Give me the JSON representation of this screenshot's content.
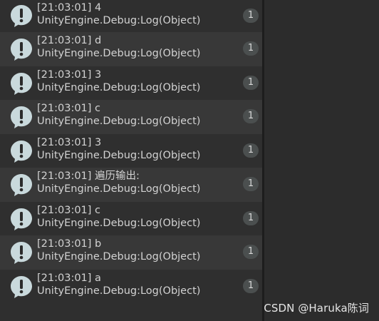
{
  "console": {
    "entries": [
      {
        "line1": "[21:03:01] 4",
        "line2": "UnityEngine.Debug:Log(Object)",
        "count": "1"
      },
      {
        "line1": "[21:03:01] d",
        "line2": "UnityEngine.Debug:Log(Object)",
        "count": "1"
      },
      {
        "line1": "[21:03:01] 3",
        "line2": "UnityEngine.Debug:Log(Object)",
        "count": "1"
      },
      {
        "line1": "[21:03:01] c",
        "line2": "UnityEngine.Debug:Log(Object)",
        "count": "1"
      },
      {
        "line1": "[21:03:01] 3",
        "line2": "UnityEngine.Debug:Log(Object)",
        "count": "1"
      },
      {
        "line1": "[21:03:01] 遍历输出:",
        "line2": "UnityEngine.Debug:Log(Object)",
        "count": "1"
      },
      {
        "line1": "[21:03:01] c",
        "line2": "UnityEngine.Debug:Log(Object)",
        "count": "1"
      },
      {
        "line1": "[21:03:01] b",
        "line2": "UnityEngine.Debug:Log(Object)",
        "count": "1"
      },
      {
        "line1": "[21:03:01] a",
        "line2": "UnityEngine.Debug:Log(Object)",
        "count": "1"
      }
    ],
    "icon": "info-message-icon"
  },
  "watermark": "CSDN @Haruka陈词",
  "colors": {
    "background": "#2c2c2c",
    "row_odd": "#2f2f2f",
    "row_even": "#383838",
    "text": "#d2d2d2",
    "icon": "#c9d9dc",
    "badge": "#4b4f4f"
  }
}
